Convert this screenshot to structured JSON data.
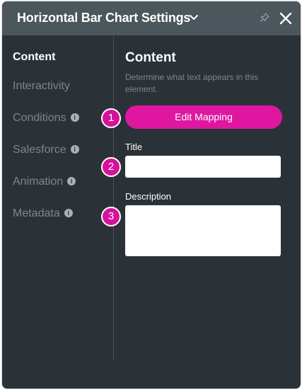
{
  "header": {
    "title": "Horizontal Bar Chart Settings"
  },
  "sidebar": {
    "items": [
      {
        "label": "Content",
        "active": true,
        "info": false
      },
      {
        "label": "Interactivity",
        "active": false,
        "info": false
      },
      {
        "label": "Conditions",
        "active": false,
        "info": true
      },
      {
        "label": "Salesforce",
        "active": false,
        "info": true
      },
      {
        "label": "Animation",
        "active": false,
        "info": true
      },
      {
        "label": "Metadata",
        "active": false,
        "info": true
      }
    ],
    "info_glyph": "i"
  },
  "content": {
    "title": "Content",
    "description": "Determine what text appears in this element.",
    "edit_mapping_label": "Edit Mapping",
    "title_field": {
      "label": "Title",
      "value": "",
      "placeholder": ""
    },
    "description_field": {
      "label": "Description",
      "value": "",
      "placeholder": ""
    }
  },
  "callouts": [
    "1",
    "2",
    "3"
  ],
  "colors": {
    "panel_bg": "#2a3238",
    "header_bg": "#4b565d",
    "accent": "#df16a0",
    "muted_text": "#7c868c"
  },
  "icons": [
    "chevron-down-icon",
    "pin-icon",
    "close-icon",
    "info-icon"
  ]
}
